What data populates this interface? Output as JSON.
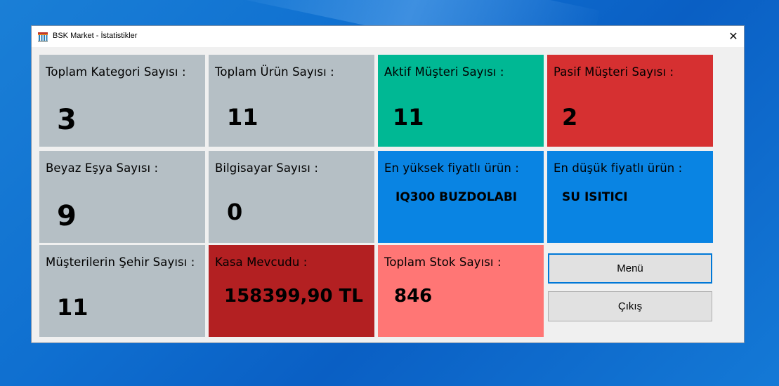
{
  "window": {
    "title": "BSK Market - İstatistikler",
    "close_glyph": "✕"
  },
  "tiles": {
    "toplam_kategori": {
      "label": "Toplam Kategori Sayısı :",
      "value": "3",
      "color": "#b5bfc5"
    },
    "toplam_urun": {
      "label": "Toplam Ürün Sayısı :",
      "value": "11",
      "color": "#b5bfc5"
    },
    "aktif_musteri": {
      "label": "Aktif Müşteri Sayısı :",
      "value": "11",
      "color": "#00b894"
    },
    "pasif_musteri": {
      "label": "Pasif Müşteri Sayısı :",
      "value": "2",
      "color": "#d63031"
    },
    "beyaz_esya": {
      "label": "Beyaz Eşya Sayısı :",
      "value": "9",
      "color": "#b5bfc5"
    },
    "bilgisayar": {
      "label": "Bilgisayar Sayısı :",
      "value": "0",
      "color": "#b5bfc5"
    },
    "en_yuksek": {
      "label": "En yüksek fiyatlı ürün :",
      "value": "IQ300 BUZDOLABI",
      "color": "#0984e3"
    },
    "en_dusuk": {
      "label": "En düşük fiyatlı ürün :",
      "value": "SU ISITICI",
      "color": "#0984e3"
    },
    "sehir": {
      "label": "Müşterilerin Şehir Sayısı :",
      "value": "11",
      "color": "#b5bfc5"
    },
    "kasa": {
      "label": "Kasa Mevcudu :",
      "value": "158399,90 TL",
      "color": "#b32022"
    },
    "stok": {
      "label": "Toplam Stok Sayısı :",
      "value": "846",
      "color": "#ff7675"
    }
  },
  "buttons": {
    "menu": "Menü",
    "cikis": "Çıkış"
  }
}
